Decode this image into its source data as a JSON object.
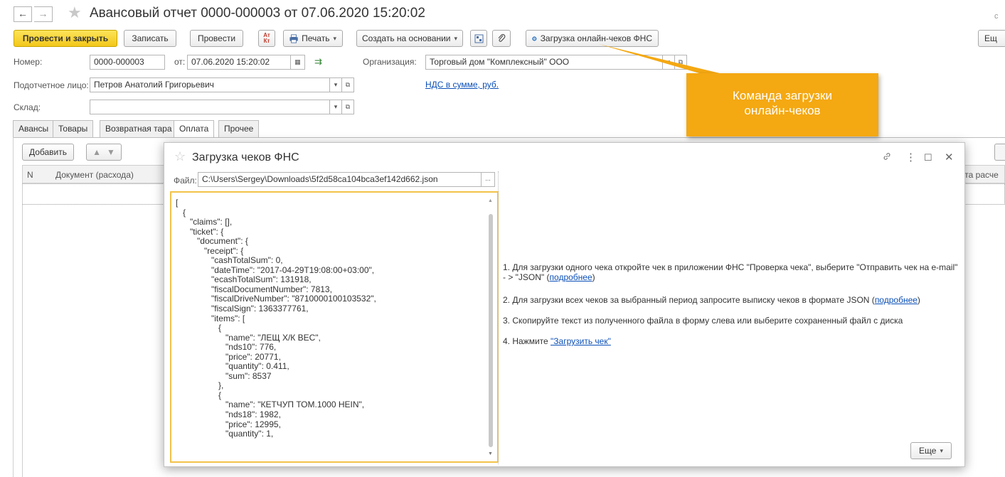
{
  "window": {
    "title": "Авансовый отчет 0000-000003 от 07.06.2020 15:20:02",
    "back_glyph": "←",
    "forward_glyph": "→",
    "star_glyph": "★",
    "corner_more": "Ещ"
  },
  "toolbar": {
    "post_close": "Провести и закрыть",
    "save": "Записать",
    "post": "Провести",
    "dt_kt_top": "Ат",
    "dt_kt_bottom": "Кт",
    "print": "Печать",
    "create_based": "Создать на основании",
    "load_checks": "Загрузка онлайн-чеков ФНС"
  },
  "form": {
    "number_label": "Номер:",
    "number_value": "0000-000003",
    "date_label": "от:",
    "date_value": "07.06.2020 15:20:02",
    "org_label": "Организация:",
    "org_value": "Торговый дом \"Комплексный\" ООО",
    "person_label": "Подотчетное лицо:",
    "person_value": "Петров Анатолий Григорьевич",
    "vat_link": "НДС в сумме, руб.",
    "warehouse_label": "Склад:",
    "warehouse_value": ""
  },
  "tabs": [
    "Авансы",
    "Товары",
    "Возвратная тара",
    "Оплата",
    "Прочее"
  ],
  "active_tab": "Оплата",
  "grid": {
    "add_button": "Добавить",
    "col_n": "N",
    "col_doc": "Документ (расхода)",
    "col_right": "ета расче"
  },
  "modal": {
    "title": "Загрузка чеков ФНС",
    "file_label": "Файл:",
    "file_value": "C:\\Users\\Sergey\\Downloads\\5f2d58ca104bca3ef142d662.json",
    "file_btn": "...",
    "json_text": "[\n   {\n      \"claims\": [],\n      \"ticket\": {\n         \"document\": {\n            \"receipt\": {\n               \"cashTotalSum\": 0,\n               \"dateTime\": \"2017-04-29T19:08:00+03:00\",\n               \"ecashTotalSum\": 131918,\n               \"fiscalDocumentNumber\": 7813,\n               \"fiscalDriveNumber\": \"8710000100103532\",\n               \"fiscalSign\": 1363377761,\n               \"items\": [\n                  {\n                     \"name\": \"ЛЕЩ Х/К ВЕС\",\n                     \"nds10\": 776,\n                     \"price\": 20771,\n                     \"quantity\": 0.411,\n                     \"sum\": 8537\n                  },\n                  {\n                     \"name\": \"КЕТЧУП ТОМ.1000 HEIN\",\n                     \"nds18\": 1982,\n                     \"price\": 12995,\n                     \"quantity\": 1,",
    "instructions": {
      "i1_line1": "1. Для загрузки одного чека откройте чек в приложении ФНС \"Проверка чека\", выберите \"Отправить чек на e-mail\"",
      "i1_line2_pre": "- > \"JSON\" (",
      "i1_link": "подробнее",
      "i1_post": ")",
      "i2_pre": "2. Для загрузки всех чеков за выбранный период запросите выписку чеков в формате JSON (",
      "i2_link": "подробнее",
      "i2_post": ")",
      "i3": "3. Скопируйте текст из полученного файла в форму слева или выберите сохраненный файл с диска",
      "i4_pre": "4. Нажмите ",
      "i4_link": "\"Загрузить чек\""
    },
    "more_button": "Еще"
  },
  "callout": {
    "line1": "Команда загрузки",
    "line2": "онлайн-чеков"
  },
  "colors": {
    "primary_button": "#f2c71a",
    "callout": "#f4a812",
    "json_border": "#f2c24a",
    "link": "#0b4fb7"
  }
}
